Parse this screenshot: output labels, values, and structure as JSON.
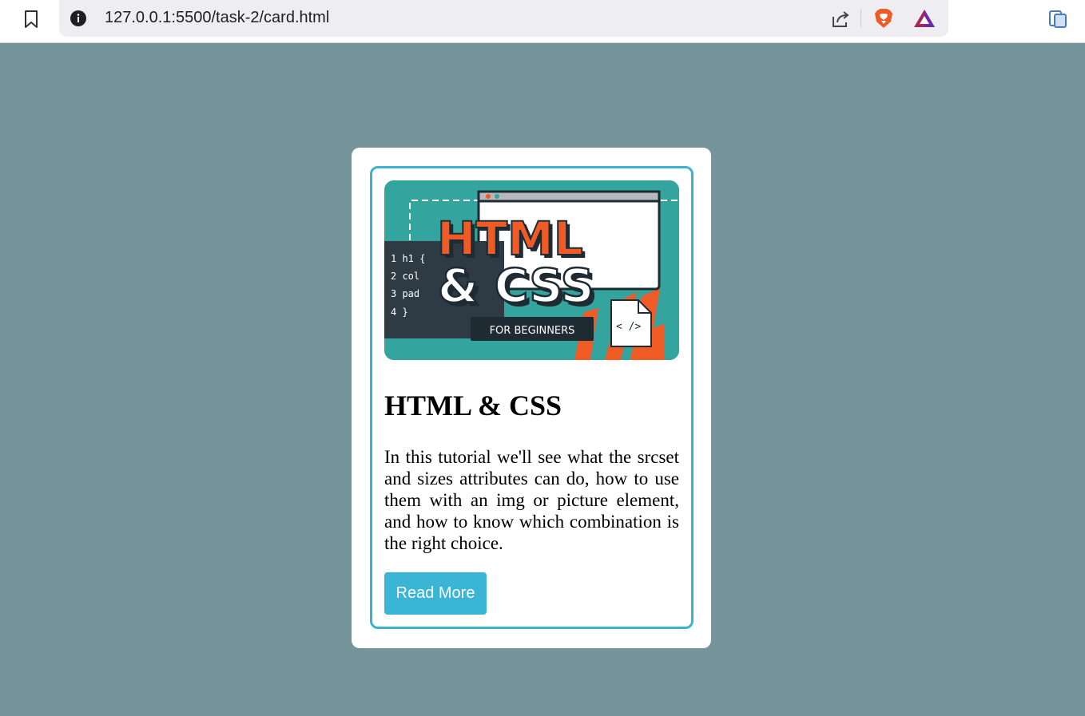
{
  "browser": {
    "url": "127.0.0.1:5500/task-2/card.html",
    "icons": [
      "bookmark-icon",
      "info-icon",
      "share-icon",
      "brave-shield-icon",
      "rewards-icon",
      "wallet-icon"
    ]
  },
  "card": {
    "image": {
      "title_line1": "HTML",
      "title_line2": "& CSS",
      "badge": "FOR BEGINNERS",
      "code_lines": [
        "1 h1 {",
        "2   col",
        "3   pad",
        "4 }"
      ],
      "code_tag": "< />"
    },
    "title": "HTML & CSS",
    "description": "In this tutorial we'll see what the srcset and sizes attributes can do, how to use them with an img or picture element, and how to know which combination is the right choice.",
    "button_label": "Read More"
  },
  "colors": {
    "page_background": "#76959a",
    "card_border": "#3bb3cf",
    "button": "#3bb5d6"
  }
}
